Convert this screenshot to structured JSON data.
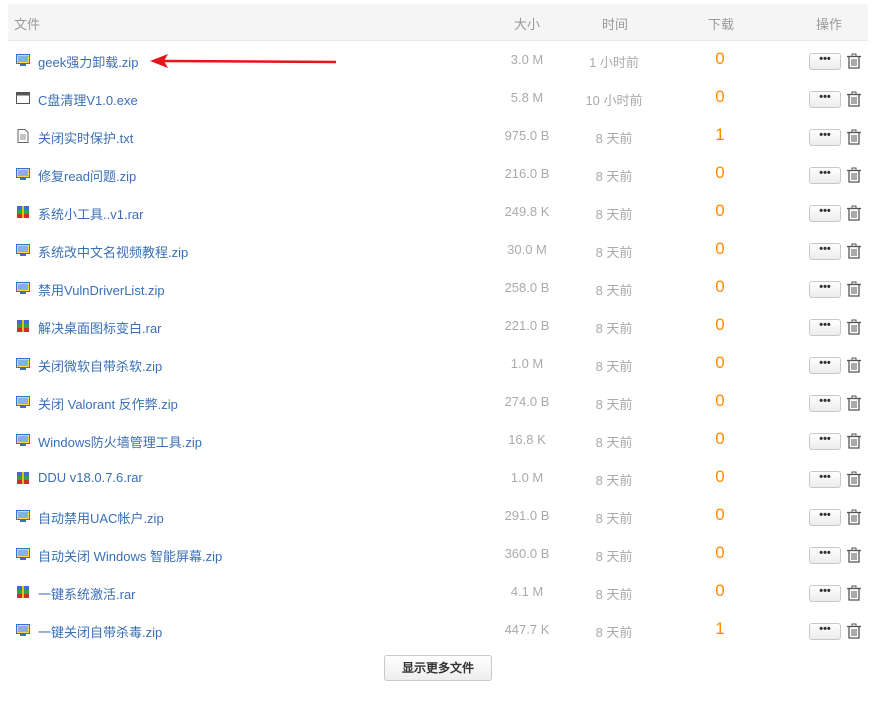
{
  "header": {
    "name": "文件",
    "size": "大小",
    "time": "时间",
    "downloads": "下载",
    "actions": "操作"
  },
  "files": [
    {
      "name": "geek强力卸载.zip",
      "size": "3.0 M",
      "time": "1 小时前",
      "downloads": "0",
      "type": "zip"
    },
    {
      "name": "C盘清理V1.0.exe",
      "size": "5.8 M",
      "time": "10 小时前",
      "downloads": "0",
      "type": "exe"
    },
    {
      "name": "关闭实时保护.txt",
      "size": "975.0 B",
      "time": "8 天前",
      "downloads": "1",
      "type": "txt"
    },
    {
      "name": "修复read问题.zip",
      "size": "216.0 B",
      "time": "8 天前",
      "downloads": "0",
      "type": "zip"
    },
    {
      "name": "系统小工具..v1.rar",
      "size": "249.8 K",
      "time": "8 天前",
      "downloads": "0",
      "type": "rar"
    },
    {
      "name": "系统改中文名视频教程.zip",
      "size": "30.0 M",
      "time": "8 天前",
      "downloads": "0",
      "type": "zip"
    },
    {
      "name": "禁用VulnDriverList.zip",
      "size": "258.0 B",
      "time": "8 天前",
      "downloads": "0",
      "type": "zip"
    },
    {
      "name": "解决桌面图标变白.rar",
      "size": "221.0 B",
      "time": "8 天前",
      "downloads": "0",
      "type": "rar"
    },
    {
      "name": "关闭微软自带杀软.zip",
      "size": "1.0 M",
      "time": "8 天前",
      "downloads": "0",
      "type": "zip"
    },
    {
      "name": "关闭 Valorant 反作弊.zip",
      "size": "274.0 B",
      "time": "8 天前",
      "downloads": "0",
      "type": "zip"
    },
    {
      "name": "Windows防火墙管理工具.zip",
      "size": "16.8 K",
      "time": "8 天前",
      "downloads": "0",
      "type": "zip"
    },
    {
      "name": "DDU v18.0.7.6.rar",
      "size": "1.0 M",
      "time": "8 天前",
      "downloads": "0",
      "type": "rar"
    },
    {
      "name": "自动禁用UAC帐户.zip",
      "size": "291.0 B",
      "time": "8 天前",
      "downloads": "0",
      "type": "zip"
    },
    {
      "name": "自动关闭 Windows 智能屏幕.zip",
      "size": "360.0 B",
      "time": "8 天前",
      "downloads": "0",
      "type": "zip"
    },
    {
      "name": "一键系统激活.rar",
      "size": "4.1 M",
      "time": "8 天前",
      "downloads": "0",
      "type": "rar"
    },
    {
      "name": "一键关闭自带杀毒.zip",
      "size": "447.7 K",
      "time": "8 天前",
      "downloads": "1",
      "type": "zip"
    }
  ],
  "more_button": "•••",
  "show_more_label": "显示更多文件",
  "colors": {
    "link": "#3a6fb6",
    "downloads": "#ff8a00",
    "arrow": "#e8141c"
  },
  "icons": {
    "row_actions": [
      "more-icon",
      "trash-icon"
    ]
  }
}
